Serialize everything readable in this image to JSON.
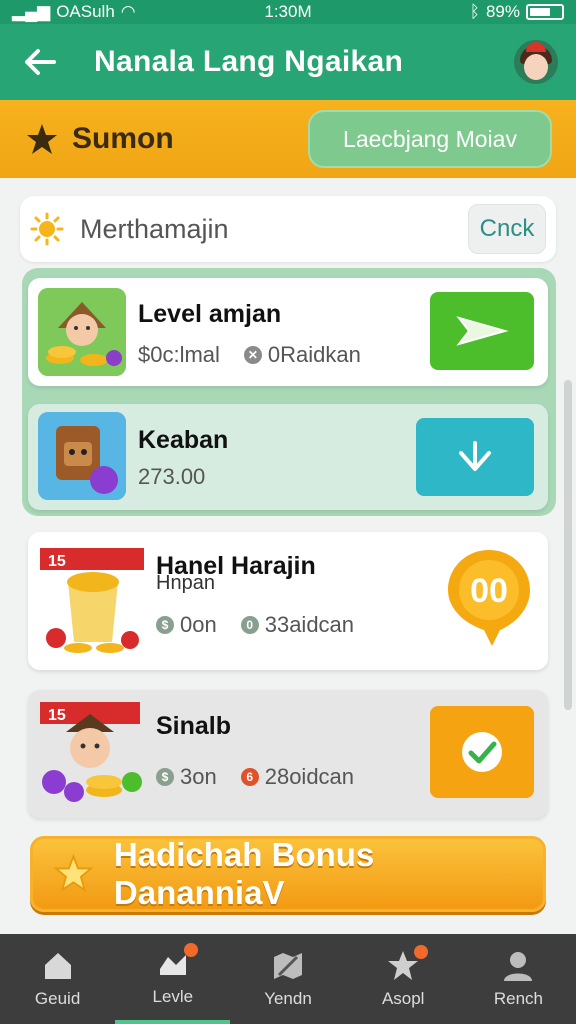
{
  "status_bar": {
    "carrier": "OASulh",
    "time": "1:30M",
    "battery": "89%"
  },
  "header": {
    "title": "Nanala Lang  Ngaikan",
    "back_icon": "arrow-left-icon",
    "avatar_icon": "user-avatar-icon"
  },
  "section": {
    "title": "Sumon",
    "button_label": "Laecbjang Moiav",
    "icon": "star-icon"
  },
  "filter": {
    "label": "Merthamajin",
    "button_label": "Cnck",
    "icon": "sun-icon"
  },
  "items": [
    {
      "name": "Level amjan",
      "meta1": "$0c:lmal",
      "meta2": "0Raidkan",
      "action_icon": "send-icon",
      "action_color": "#4cbd2b"
    },
    {
      "name": "Keaban",
      "meta1": "273.00",
      "action_icon": "chevron-down-icon",
      "action_color": "#2eb7c6"
    },
    {
      "name": "Hanel Harajin",
      "subname": "Hnpan",
      "meta1": "0on",
      "meta2": "33aidcan",
      "badge_text": "00",
      "action_color": "#f5a911"
    },
    {
      "name": "Sinalb",
      "meta1": "3on",
      "meta2": "28oidcan",
      "action_icon": "check-icon",
      "action_color": "#f5a311"
    }
  ],
  "bonus": {
    "label": "Hadichah Bonus DananniaV",
    "icon": "star-icon"
  },
  "bottom_nav": [
    {
      "label": "Geuid",
      "icon": "home-icon",
      "badge": false
    },
    {
      "label": "Levle",
      "icon": "chart-icon",
      "badge": true,
      "active": true
    },
    {
      "label": "Yendn",
      "icon": "map-icon",
      "badge": false
    },
    {
      "label": "Asopl",
      "icon": "star-icon",
      "badge": true
    },
    {
      "label": "Rench",
      "icon": "profile-icon",
      "badge": false
    }
  ],
  "colors": {
    "header": "#27a574",
    "section": "#f6b21e",
    "group": "#a9d8b7"
  }
}
